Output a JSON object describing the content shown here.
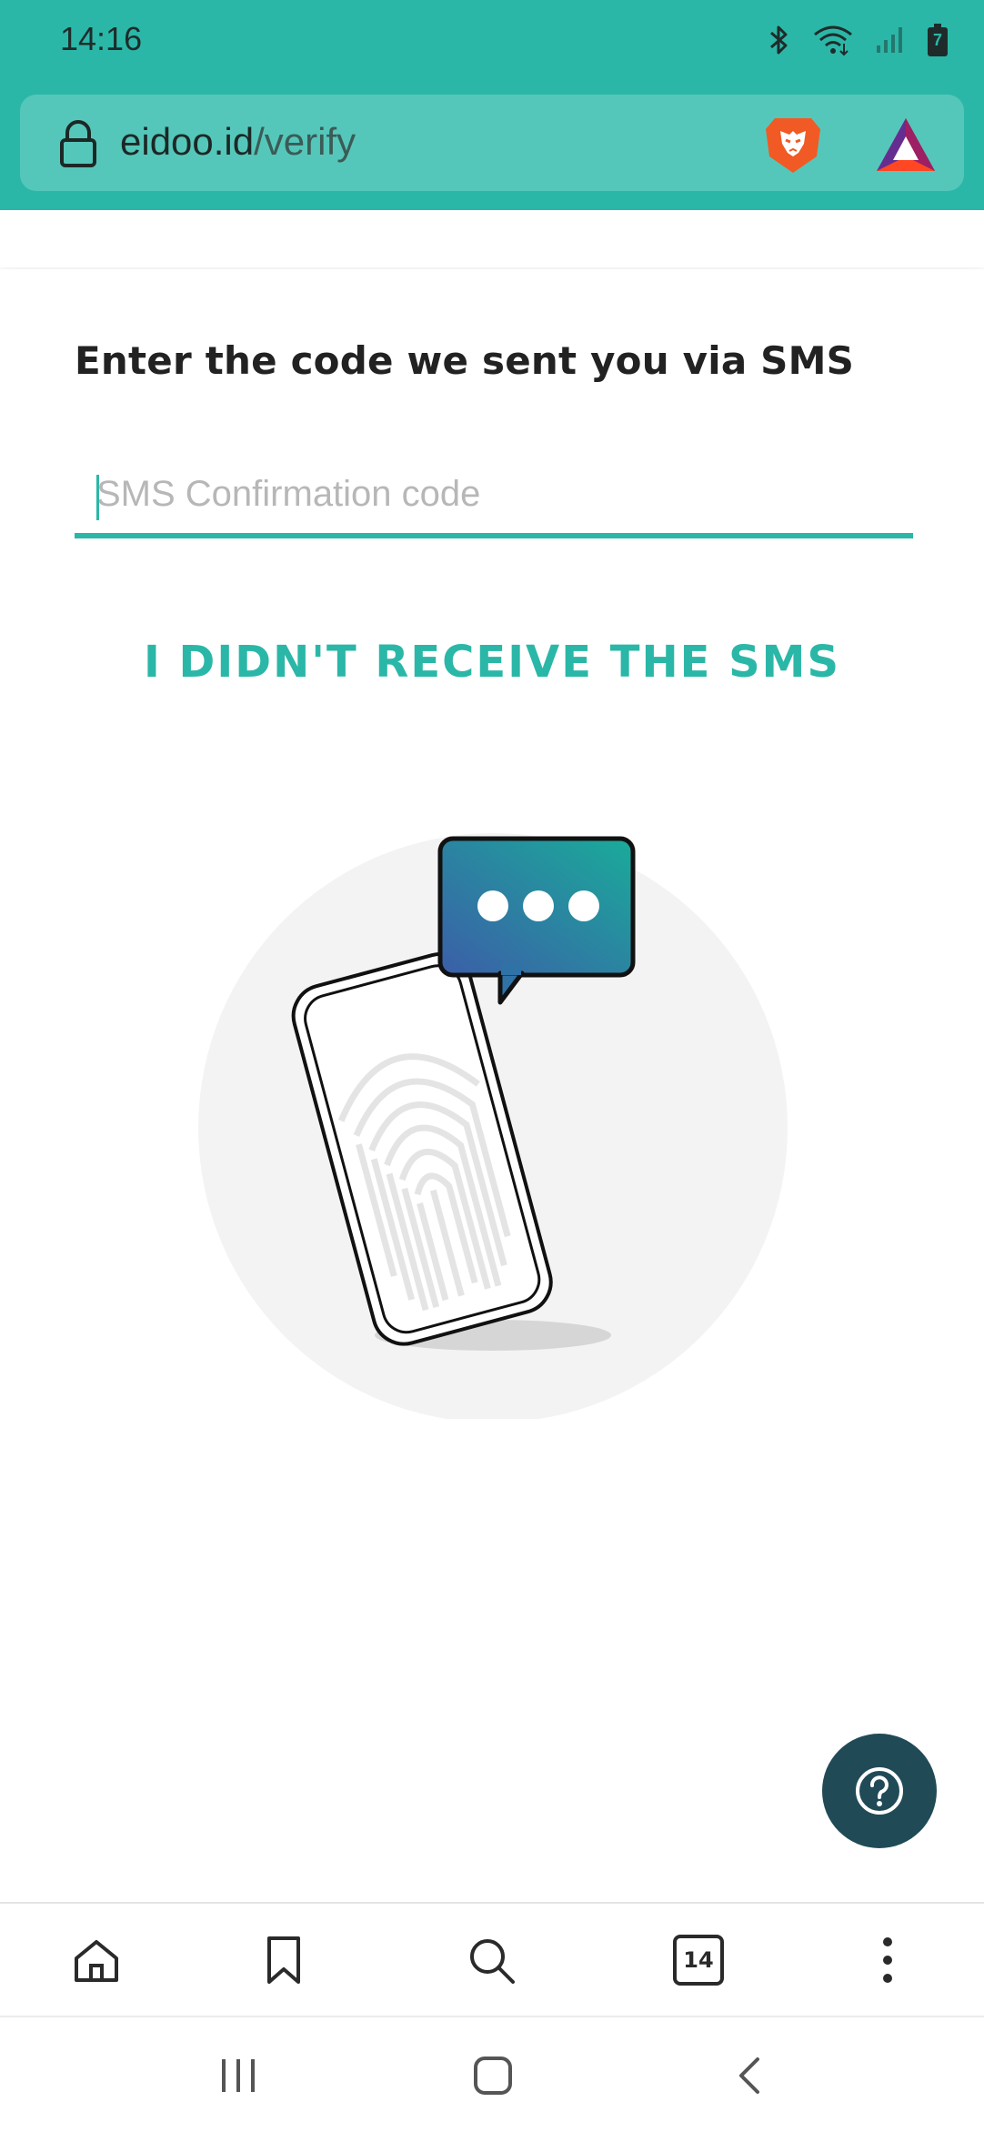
{
  "status_bar": {
    "time": "14:16",
    "battery_level": "7",
    "icons": [
      "bluetooth-icon",
      "wifi-icon",
      "signal-icon",
      "battery-icon"
    ]
  },
  "url_bar": {
    "domain": "eidoo.id",
    "path": "/verify",
    "icons": [
      "lock-icon",
      "brave-shields-icon",
      "bat-rewards-icon"
    ]
  },
  "page": {
    "heading": "Enter the code we sent you via SMS",
    "code_input": {
      "placeholder": "SMS Confirmation code",
      "value": ""
    },
    "resend_link": "I DIDN'T RECEIVE THE SMS",
    "illustration": "phone-sms-fingerprint-illustration"
  },
  "help_button": {
    "icon": "question-icon"
  },
  "browser_toolbar": {
    "buttons": [
      "home-icon",
      "bookmark-icon",
      "search-icon",
      "tabs-icon",
      "menu-icon"
    ],
    "tab_count": "14"
  },
  "system_nav": {
    "buttons": [
      "recents-icon",
      "home-button-icon",
      "back-icon"
    ]
  },
  "colors": {
    "accent": "#2bb7a7",
    "help_button": "#214a57",
    "bubble_gradient_start": "#3b5ea8",
    "bubble_gradient_end": "#1aab9a"
  }
}
